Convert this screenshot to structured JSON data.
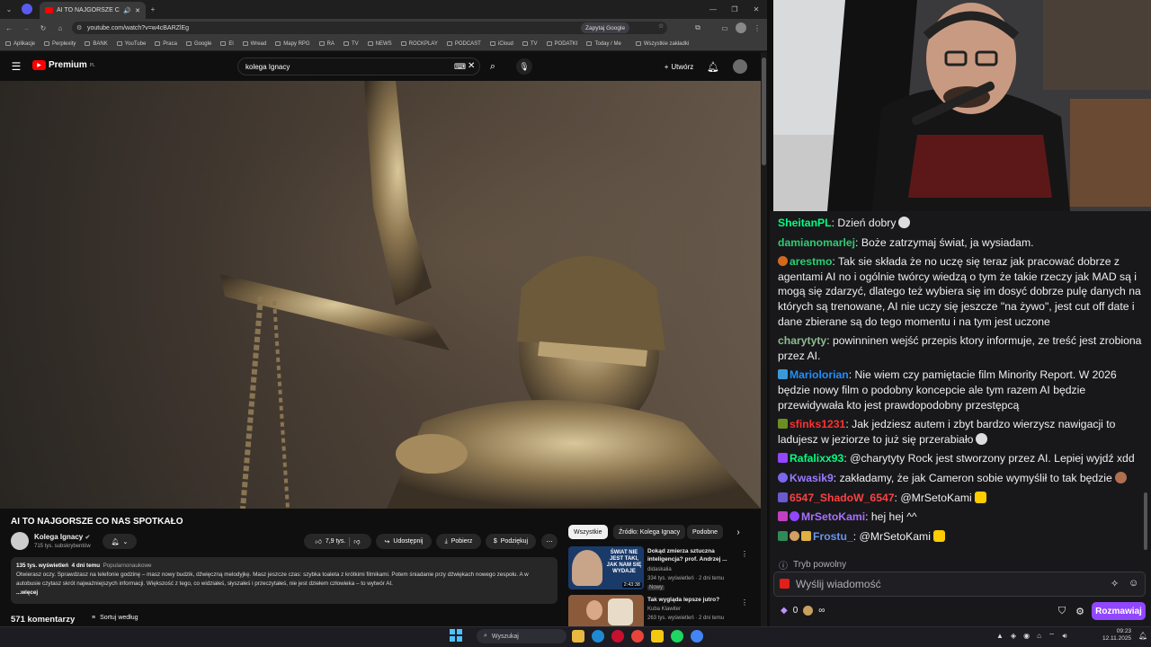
{
  "browser": {
    "tab_title": "AI TO NAJGORSZE CO NAS...",
    "url": "youtube.com/watch?v=w4cBARZlEg",
    "ask_google": "Zapytaj Google",
    "bookmarks": [
      "Aplikacje",
      "Perplexity",
      "BANK",
      "YouTube",
      "Praca",
      "Google",
      "El",
      "Wread",
      "Mapy RPG",
      "RA",
      "TV",
      "NEWS",
      "ROCKPLAY",
      "PODCAST",
      "iCloud",
      "TV",
      "PODATKI",
      "Today / Me"
    ],
    "bookmarks_all": "Wszystkie zakładki"
  },
  "youtube": {
    "logo": "Premium",
    "logo_sup": "PL",
    "search_value": "kolega Ignacy",
    "create_label": "Utwórz",
    "video_title": "AI TO NAJGORSZE CO NAS SPOTKAŁO",
    "channel_name": "Kolega Ignacy",
    "subscribers": "715 tys. subskrybentów",
    "likes": "7,9 tys.",
    "share": "Udostępnij",
    "download": "Pobierz",
    "thanks": "Podziękuj",
    "views_line": "135 tys. wyświetleń",
    "date_line": "4 dni temu",
    "tag_line": "Popularnonaukowe",
    "description": "Otwierasz oczy. Sprawdzasz na telefonie godzinę – masz nowy budzik, dźwięczną melodyjkę. Masz jeszcze czas: szybka toaleta z krótkimi filmikami. Potem śniadanie przy dźwiękach nowego zespołu. A w autobusie czytasz skrót najważniejszych informacji. Większość z tego, co widziałeś, słyszałeś i przeczytałeś, nie jest dziełem człowieka – to wytwór AI.",
    "more": "...więcej",
    "comments": "571 komentarzy",
    "sort": "Sortuj według",
    "chips": [
      "Wszystkie",
      "Źródło: Kolega Ignacy",
      "Podobne"
    ],
    "recs": [
      {
        "title": "Dokąd zmierza sztuczna inteligencja? prof. Andrzej ...",
        "channel": "didaskalia",
        "meta": "334 tys. wyświetleń · 2 dni temu",
        "badge": "Nowy",
        "duration": "2:43:38",
        "thumb_text": "ŚWIAT NIE JEST TAKI, JAK NAM SIĘ WYDAJE"
      },
      {
        "title": "Tak wygląda lepsze jutro?",
        "channel": "Kuba Klawiter",
        "meta": "263 tys. wyświetleń · 2 dni temu",
        "badge": "",
        "duration": "",
        "thumb_text": ""
      }
    ]
  },
  "chat": {
    "messages": [
      {
        "user": "SheitanPL",
        "color": "#00ff7f",
        "text": "Dzień dobry",
        "badge": ""
      },
      {
        "user": "damianomarlej",
        "color": "#2ecc71",
        "text": "Boże zatrzymaj świat, ja wysiadam.",
        "badge": ""
      },
      {
        "user": "arestmo",
        "color": "#2ecc71",
        "text": "Tak sie składa że no uczę się teraz jak pracować dobrze z agentami AI no i ogólnie twórcy wiedzą o tym że takie rzeczy jak MAD są i mogą się zdarzyć, dlatego też wybiera się im dosyć dobrze pulę danych na których są trenowane, AI nie uczy się jeszcze \"na żywo\", jest cut off date i dane zbierane są do tego momentu i na tym jest uczone",
        "badge": "#d2691e"
      },
      {
        "user": "charytyty",
        "color": "#8fbc8f",
        "text": "powinninen wejść przepis ktory informuje, ze treść jest zrobiona przez AI.",
        "badge": ""
      },
      {
        "user": "Mariolorian",
        "color": "#1e90ff",
        "text": "Nie wiem czy pamiętacie film Minority Report. W 2026 będzie nowy film o podobny koncepcie ale tym razem AI będzie przewidywała kto jest prawdopodobny przestępcą",
        "badge": "#3a9ad9"
      },
      {
        "user": "sfinks1231",
        "color": "#ff3030",
        "text": "Jak jedziesz autem i zbyt bardzo wierzysz nawigacji to ladujesz w jeziorze to już się przerabiało",
        "badge": "#6b8e23"
      },
      {
        "user": "Rafalixx93",
        "color": "#00ff7f",
        "text": "@charytyty Rock jest stworzony przez AI. Lepiej wyjdź xdd",
        "badge": "#9147ff"
      },
      {
        "user": "Kwasik9",
        "color": "#9a7bff",
        "text": "zakładamy, że jak Cameron sobie wymyślił to tak będzie",
        "badge": "#7b68ee"
      },
      {
        "user": "6547_ShadoW_6547",
        "color": "#ff4040",
        "text": "@MrSetoKami",
        "badge": "#6a5acd"
      },
      {
        "user": "MrSetoKami",
        "color": "#a970ff",
        "text": "hej hej ^^",
        "badge": "#c040c0"
      },
      {
        "user": "Frostu_",
        "color": "#6495ed",
        "text": "@MrSetoKami",
        "badge": "#2e8b57"
      }
    ],
    "mode": "Tryb powolny",
    "placeholder": "Wyślij wiadomość",
    "points": "0",
    "send": "Rozmawiaj"
  },
  "taskbar": {
    "search": "Wyszukaj",
    "time": "09:23",
    "date": "12.11.2025"
  }
}
